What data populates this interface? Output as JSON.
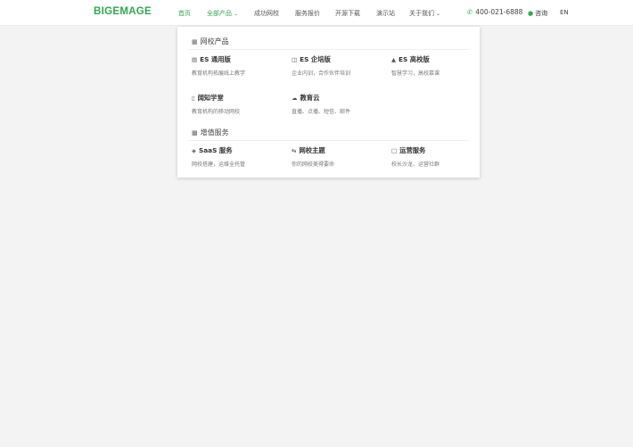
{
  "header": {
    "logo": "BIGEMAGE",
    "nav": [
      {
        "label": "首页"
      },
      {
        "label": "全部产品"
      },
      {
        "label": "成功网校"
      },
      {
        "label": "服务报价"
      },
      {
        "label": "开源下载"
      },
      {
        "label": "演示站"
      },
      {
        "label": "关于我们"
      }
    ],
    "phone": "400-021-6888",
    "consult": "咨询",
    "lang": "EN"
  },
  "dropdown": {
    "products_title": "网校产品",
    "products": [
      {
        "name": "ES 通用版",
        "desc": "教育机构拓展线上教学",
        "icon": "monitor-icon"
      },
      {
        "name": "ES 企培版",
        "desc": "企业内训，合作伙伴培训",
        "icon": "building-icon"
      },
      {
        "name": "ES 高校版",
        "desc": "智慧学习，高校慕课",
        "icon": "graduation-cap-icon"
      },
      {
        "name": "阔知学堂",
        "desc": "教育机构的移动网校",
        "icon": "mobile-icon"
      },
      {
        "name": "教育云",
        "desc": "直播、点播、短信、邮件",
        "icon": "cloud-icon"
      }
    ],
    "services_title": "增值服务",
    "services": [
      {
        "name": "SaaS 服务",
        "desc": "网校搭建，运维全托管",
        "icon": "cube-icon"
      },
      {
        "name": "网校主题",
        "desc": "你的网校美得要命",
        "icon": "shuffle-icon"
      },
      {
        "name": "运营服务",
        "desc": "校长沙龙、运营社群",
        "icon": "desktop-icon"
      }
    ]
  },
  "colors": {
    "accent": "#2fa84f",
    "background": "#f3f3f3"
  }
}
